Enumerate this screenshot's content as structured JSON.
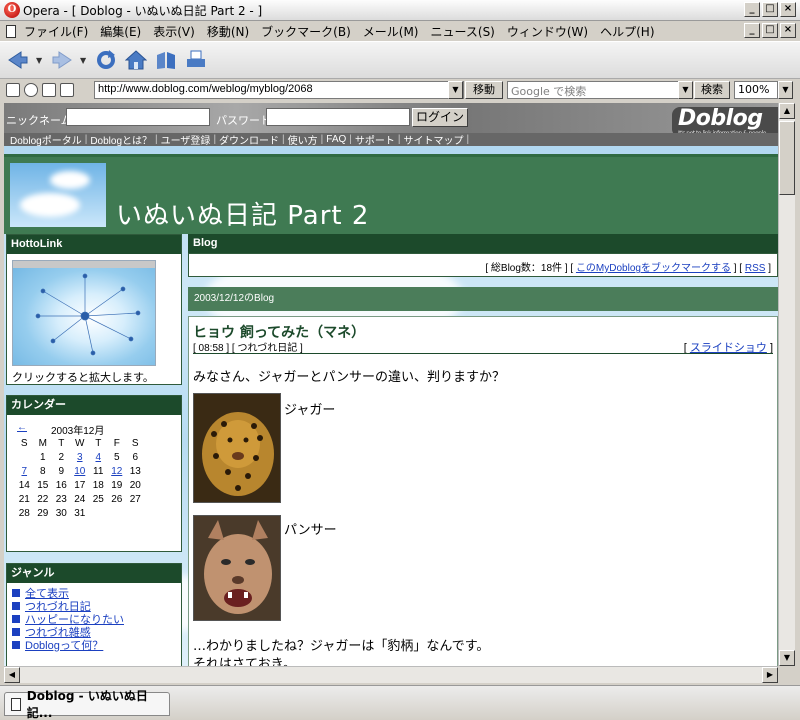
{
  "window": {
    "title": "Opera - [ Doblog - いぬいぬ日記 Part 2 - ]",
    "app_icon": "opera-o-icon",
    "controls": [
      "_",
      "□",
      "×"
    ]
  },
  "menu": {
    "items": [
      "ファイル(F)",
      "編集(E)",
      "表示(V)",
      "移動(N)",
      "ブックマーク(B)",
      "メール(M)",
      "ニュース(S)",
      "ウィンドウ(W)",
      "ヘルプ(H)"
    ]
  },
  "toolbar": {
    "icons": [
      "back-icon",
      "forward-icon",
      "reload-icon",
      "home-icon",
      "hotlist-icon",
      "print-icon"
    ]
  },
  "address_bar": {
    "url": "http://www.doblog.com/weblog/myblog/2068",
    "go_label": "移動",
    "search_placeholder": "Google で検索",
    "search_label": "検索",
    "zoom": "100%"
  },
  "site": {
    "nickname_label": "ニックネーム：",
    "password_label": "パスワード：",
    "login_label": "ログイン",
    "logo": "Doblog",
    "logo_tagline": "It's not to link information & people",
    "nav": [
      "Doblogポータル",
      "Doblogとは？",
      "ユーザ登録",
      "ダウンロード",
      "使い方",
      "FAQ",
      "サポート",
      "サイトマップ"
    ],
    "blog_title": "いぬいぬ日記 Part 2"
  },
  "sidebar": {
    "hottolink": {
      "heading": "HottoLink",
      "caption": "クリックすると拡大します。"
    },
    "calendar": {
      "heading": "カレンダー",
      "prev": "←",
      "month": "2003年12月",
      "weekdays": [
        "S",
        "M",
        "T",
        "W",
        "T",
        "F",
        "S"
      ],
      "weeks": [
        [
          "",
          "1",
          "2",
          "3",
          "4",
          "5",
          "6"
        ],
        [
          "7",
          "8",
          "9",
          "10",
          "11",
          "12",
          "13"
        ],
        [
          "14",
          "15",
          "16",
          "17",
          "18",
          "19",
          "20"
        ],
        [
          "21",
          "22",
          "23",
          "24",
          "25",
          "26",
          "27"
        ],
        [
          "28",
          "29",
          "30",
          "31",
          "",
          "",
          ""
        ]
      ],
      "linked_days": [
        "3",
        "4",
        "7",
        "10",
        "12"
      ]
    },
    "genre": {
      "heading": "ジャンル",
      "items": [
        "全て表示",
        "つれづれ日記",
        "ハッピーになりたい",
        "つれづれ雑感",
        "Doblogって何？"
      ]
    }
  },
  "main": {
    "blog_heading": "Blog",
    "stats_prefix": "[ 総Blog数：18件 ] [",
    "bookmark_link": "このMyDoblogをブックマークする",
    "stats_mid": "] [",
    "rss_link": "RSS",
    "stats_suffix": "]",
    "date_heading": "2003/12/12のBlog",
    "post": {
      "title": "ヒョウ 飼ってみた（マネ）",
      "meta": "[ 08:58 ] [ つれづれ日記 ]",
      "slide_prefix": "[",
      "slide_link": "スライドショウ",
      "slide_suffix": "]",
      "intro": "みなさん、ジャガーとパンサーの違い、判りますか？",
      "caption1": "ジャガー",
      "caption2": "パンサー",
      "line1": "…わかりましたね？ジャガーは「豹柄」なんです。",
      "line2": "それはさておき。"
    }
  },
  "tabbar": {
    "tab_label": "Doblog - いぬいぬ日記..."
  },
  "colors": {
    "accent_green": "#1c4a2b",
    "banner_green": "#3f7a52",
    "link_blue": "#1b40c0"
  }
}
